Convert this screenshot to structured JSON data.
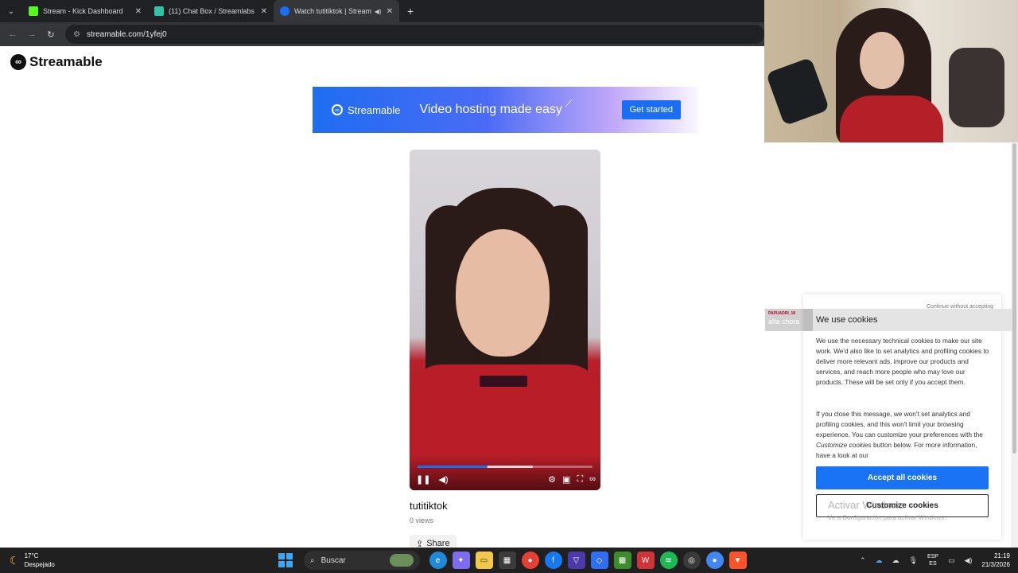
{
  "tabs": [
    {
      "title": "Stream - Kick Dashboard",
      "color": "#53fc18"
    },
    {
      "title": "(11) Chat Box / Streamlabs",
      "color": "#31c3a2"
    },
    {
      "title": "Watch tutitiktok | Streamab",
      "color": "#1a6ef5"
    }
  ],
  "address": "streamable.com/1yfej0",
  "site": {
    "name": "Streamable"
  },
  "banner": {
    "brand": "Streamable",
    "tagline": "Video hosting made easy",
    "cta": "Get started"
  },
  "video": {
    "title": "tutitiktok",
    "views": "0 views",
    "share": "Share",
    "progress_fraction": 0.4,
    "buffered_fraction": 0.66
  },
  "chat": {
    "user": "PAPUADRI_18",
    "message": "alta chora"
  },
  "cookie": {
    "continue": "Continue without accepting",
    "title": "We use cookies",
    "p1": "We use the necessary technical cookies to make our site work. We'd also like to set analytics and profiling cookies to deliver more relevant ads, improve our products and services, and reach more people who may love our products. These will be set only if you accept them.",
    "p2_a": "If you close this message, we won't set analytics and profiling cookies, and this won't limit your browsing experience. You can customize your preferences with the ",
    "p2_em": "Customize cookies",
    "p2_b": " button below. For more information, have a look at our",
    "accept": "Accept all cookies",
    "customize": "Customize cookies"
  },
  "watermark": {
    "line1": "Activar Windows",
    "line2": "Ve a Configuración para activar Windows."
  },
  "taskbar": {
    "temp": "17°C",
    "weather": "Despejado",
    "search": "Buscar",
    "lang1": "ESP",
    "lang2": "ES",
    "time": "21:19",
    "date": "21/3/2026"
  }
}
